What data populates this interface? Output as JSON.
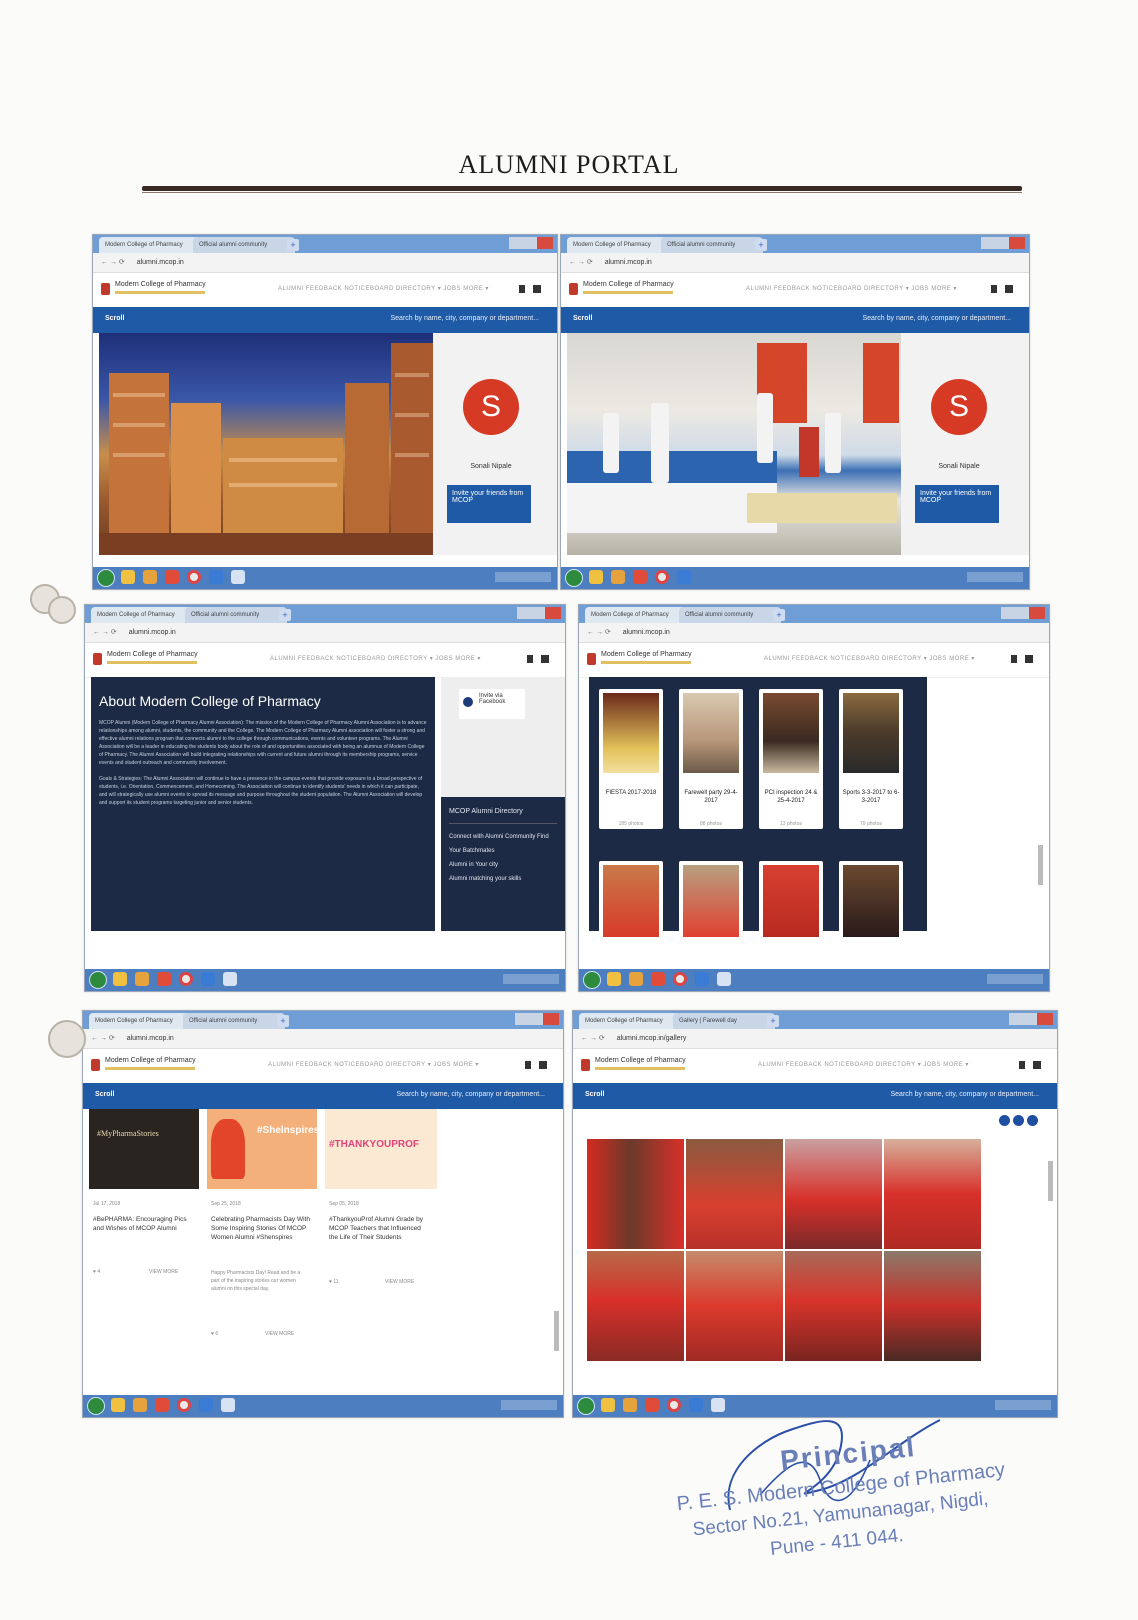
{
  "page": {
    "title": "ALUMNI PORTAL"
  },
  "browser": {
    "tab_label": "Modern College of Pharmacy",
    "tab2_label": "Official alumni community",
    "tab2_label_panel6": "Gallery | Farewell day",
    "url": "alumni.mcop.in",
    "url_panel6": "alumni.mcop.in/gallery"
  },
  "site": {
    "brand": "Modern College of Pharmacy",
    "nav": "ALUMNI FEEDBACK  NOTICEBOARD  DIRECTORY ▾  JOBS  MORE ▾",
    "bar_left": "Scroll",
    "search_placeholder": "Search by name, city, company or department..."
  },
  "profile": {
    "initial": "S",
    "name": "Sonali Nipale",
    "invite": "Invite your friends from MCOP"
  },
  "about": {
    "heading": "About Modern College of Pharmacy",
    "para1": "MCOP Alumni (Modern College of Pharmacy Alumni Association): The mission of the Modern College of Pharmacy Alumni Association is to advance relationships among alumni, students, the community and the College. The Modern College of Pharmacy Alumni association will foster a strong and effective alumni relations program that connects alumni to the college through communications, events and volunteer programs. The Alumni Association will be a leader in educating the students body about the role of and opportunities associated with being an alumnus of Modern College of Pharmacy. The Alumni Association will build integrating relationships with current and future alumni through its membership programs, service events and student outreach and community involvement.",
    "para2": "Goals & Strategies: The Alumni Association will continue to have a presence in the campus events that provide exposure to a broad perspective of students, i.e. Orientation, Commencement, and Homecoming. The Association will continue to identify students' needs in which it can participate, and will strategically use alumni events to spread its message and purpose throughout the student population. The Alumni Association will develop and support its student programs targeting junior and senior students.",
    "fb": "Invite via Facebook",
    "dir_title": "MCOP Alumni Directory",
    "dir_sub": "Connect with Alumni Community Find",
    "dir_items": [
      "Your Batchmates",
      "Alumni in Your city",
      "Alumni matching your skills"
    ]
  },
  "gallery": {
    "albums": [
      {
        "title": "FIESTA 2017-2018",
        "count": "185 photos"
      },
      {
        "title": "Farewell party 29-4-2017",
        "count": "88 photos"
      },
      {
        "title": "PCI inspection 24 & 25-4-2017",
        "count": "13 photos"
      },
      {
        "title": "Sports 3-3-2017 to 6-3-2017",
        "count": "79 photos"
      }
    ]
  },
  "posts": [
    {
      "date": "Jul 17, 2018",
      "title": "#BePHARMA: Encouraging Pics and Wishes of MCOP Alumni",
      "foot_left": "♥ 4",
      "foot_right": "VIEW MORE"
    },
    {
      "date": "Sep 25, 2018",
      "title": "Celebrating Pharmacists Day With Some Inspiring Stories Of MCOP Women Alumni #Shenspires",
      "excerpt": "Happy Pharmacists Day! Read and be a part of the inspiring stories our women alumni on this special day.",
      "foot_left": "♥ 6",
      "foot_right": "VIEW MORE"
    },
    {
      "date": "Sep 05, 2018",
      "title": "#ThankyouProf Alumni Grade by MCOP Teachers that Influenced the Life of Their Students",
      "foot_left": "♥ 11",
      "foot_right": "VIEW MORE"
    }
  ],
  "post_banners": [
    "#MyPharmaStories",
    "#Shelnspires",
    "#THANKYOUPROF"
  ],
  "stamp": {
    "line1": "Principal",
    "line2": "P. E. S. Modern College of Pharmacy",
    "line3": "Sector No.21, Yamunanagar, Nigdi,",
    "line4": "Pune - 411 044."
  }
}
